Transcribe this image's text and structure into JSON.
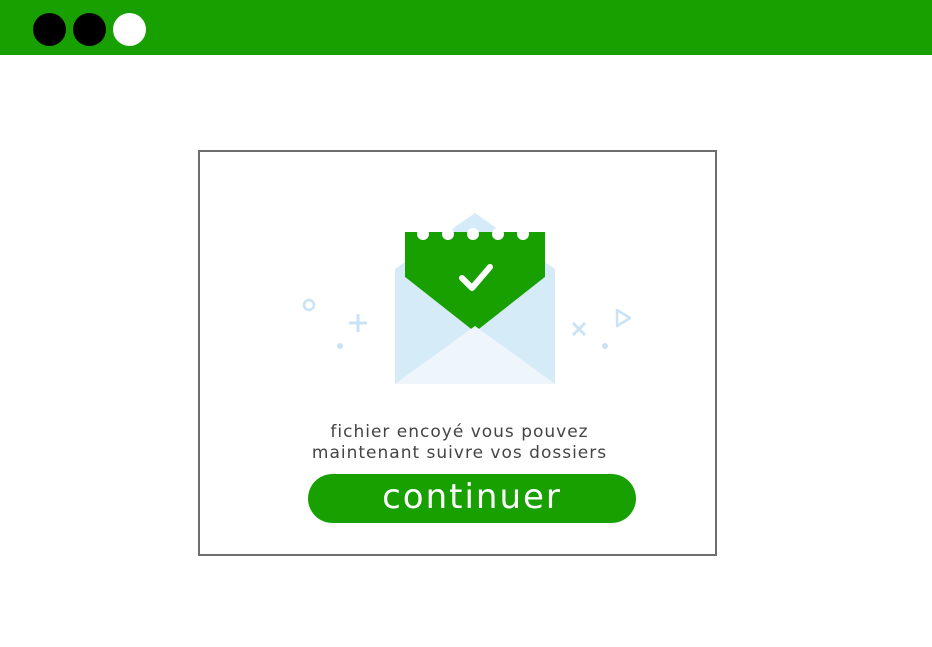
{
  "window": {
    "controls": [
      "close-dot",
      "minimize-dot",
      "maximize-dot"
    ],
    "accent_color": "#17a000"
  },
  "dialog": {
    "icon": "envelope-check-icon",
    "message_line1": "fichier encoyé vous pouvez",
    "message_line2": "maintenant suivre vos dossiers",
    "button_label": "continuer"
  }
}
